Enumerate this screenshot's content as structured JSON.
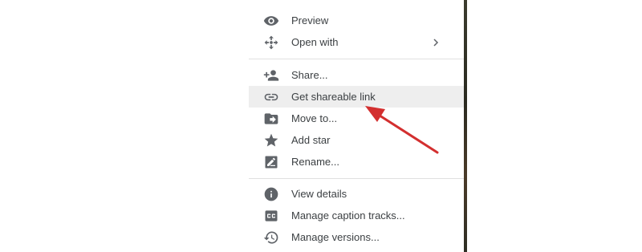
{
  "menu": {
    "items": [
      {
        "label": "Preview",
        "icon": "eye-icon"
      },
      {
        "label": "Open with",
        "icon": "move-arrows-icon"
      },
      {
        "label": "Share...",
        "icon": "person-add-icon"
      },
      {
        "label": "Get shareable link",
        "icon": "link-icon"
      },
      {
        "label": "Move to...",
        "icon": "folder-move-icon"
      },
      {
        "label": "Add star",
        "icon": "star-icon"
      },
      {
        "label": "Rename...",
        "icon": "rename-icon"
      },
      {
        "label": "View details",
        "icon": "info-icon"
      },
      {
        "label": "Manage caption tracks...",
        "icon": "closed-caption-icon"
      },
      {
        "label": "Manage versions...",
        "icon": "history-icon"
      }
    ]
  },
  "colors": {
    "icon": "#5f6368",
    "text": "#3c4043",
    "hover_bg": "#eeeeee",
    "annotation_arrow": "#d32f2f"
  }
}
